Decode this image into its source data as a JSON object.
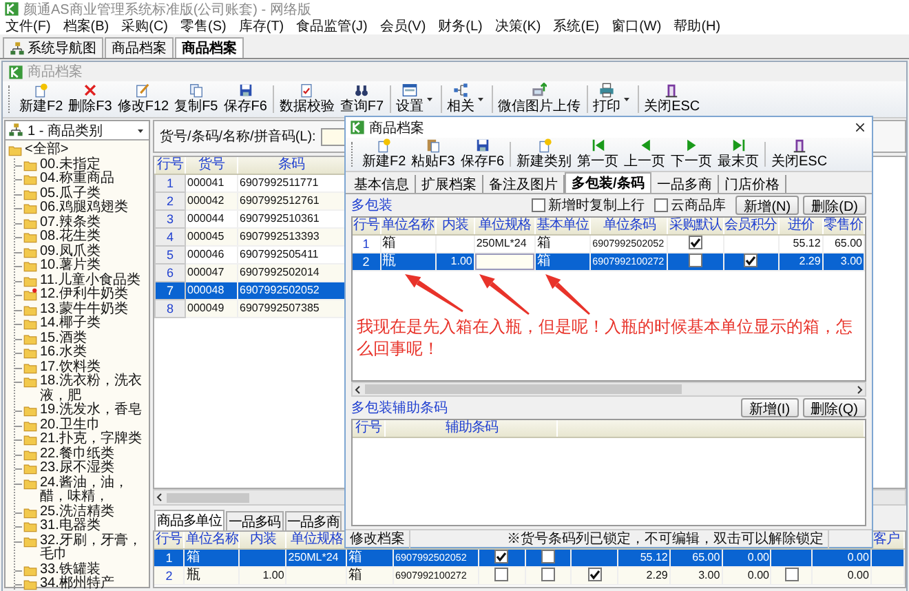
{
  "app_title": "颜通AS商业管理系统标准版(公司账套) - 网络版",
  "menu": [
    "文件(F)",
    "档案(B)",
    "采购(C)",
    "零售(S)",
    "库存(T)",
    "食品监管(J)",
    "会员(V)",
    "财务(L)",
    "决策(K)",
    "系统(E)",
    "窗口(W)",
    "帮助(H)"
  ],
  "doc_tabs": [
    {
      "label": "系统导航图",
      "kind": "navigator",
      "selected": false
    },
    {
      "label": "商品档案",
      "kind": "document",
      "selected": false
    },
    {
      "label": "商品档案",
      "kind": "document",
      "selected": true
    }
  ],
  "window": {
    "title": "商品档案",
    "toolbar": [
      {
        "label": "新建F2",
        "kind": "new",
        "group_start": false,
        "dropdown": false
      },
      {
        "label": "删除F3",
        "kind": "delete",
        "group_start": false,
        "dropdown": false
      },
      {
        "label": "修改F12",
        "kind": "edit",
        "group_start": false,
        "dropdown": false
      },
      {
        "label": "复制F5",
        "kind": "copy",
        "group_start": false,
        "dropdown": false
      },
      {
        "label": "保存F6",
        "kind": "save",
        "group_start": false,
        "dropdown": false
      },
      {
        "label": "数据校验",
        "kind": "verify",
        "group_start": true,
        "dropdown": false
      },
      {
        "label": "查询F7",
        "kind": "find",
        "group_start": false,
        "dropdown": false
      },
      {
        "label": "设置",
        "kind": "settings",
        "group_start": true,
        "dropdown": true
      },
      {
        "label": "相关",
        "kind": "related",
        "group_start": true,
        "dropdown": true
      },
      {
        "label": "微信图片上传",
        "kind": "upload",
        "group_start": true,
        "dropdown": false
      },
      {
        "label": "打印",
        "kind": "print",
        "group_start": true,
        "dropdown": true
      },
      {
        "label": "关闭ESC",
        "kind": "close",
        "group_start": true,
        "dropdown": false
      }
    ],
    "category_select": "1 - 商品类别",
    "tree": {
      "label": "<全部>",
      "expanded": true,
      "children": [
        {
          "label": "00.未指定",
          "marked": false
        },
        {
          "label": "04.称重商品",
          "marked": false
        },
        {
          "label": "05.瓜子类",
          "marked": false
        },
        {
          "label": "06.鸡腿鸡翅类",
          "marked": false
        },
        {
          "label": "07.辣条类",
          "marked": false
        },
        {
          "label": "08.花生类",
          "marked": false
        },
        {
          "label": "09.凤爪类",
          "marked": false
        },
        {
          "label": "10.薯片类",
          "marked": false
        },
        {
          "label": "11.儿童小食品类",
          "marked": false
        },
        {
          "label": "12.伊利牛奶类",
          "marked": true
        },
        {
          "label": "13.蒙牛牛奶类",
          "marked": false
        },
        {
          "label": "14.椰子类",
          "marked": false
        },
        {
          "label": "15.酒类",
          "marked": false
        },
        {
          "label": "16.水类",
          "marked": false
        },
        {
          "label": "17.饮料类",
          "marked": false
        },
        {
          "label": "18.洗衣粉，洗衣液，肥",
          "marked": false
        },
        {
          "label": "19.洗发水，香皂",
          "marked": false
        },
        {
          "label": "20.卫生巾",
          "marked": false
        },
        {
          "label": "21.扑克，字牌类",
          "marked": false
        },
        {
          "label": "22.餐巾纸类",
          "marked": false
        },
        {
          "label": "23.尿不湿类",
          "marked": false
        },
        {
          "label": "24.酱油，油，醋，味精，",
          "marked": false
        },
        {
          "label": "25.洗洁精类",
          "marked": false
        },
        {
          "label": "31.电器类",
          "marked": false
        },
        {
          "label": "32.牙刷，牙膏，毛巾",
          "marked": false
        },
        {
          "label": "33.铁罐装",
          "marked": false
        },
        {
          "label": "34.郴州特产",
          "marked": false
        }
      ]
    },
    "search": {
      "label": "货号/条码/名称/拼音码(L):"
    },
    "table": {
      "columns": [
        "行号",
        "货号",
        "条码"
      ],
      "rows": [
        {
          "cells": [
            "1",
            "000041",
            "6907992511771"
          ],
          "selected": false
        },
        {
          "cells": [
            "2",
            "000042",
            "6907992512761"
          ],
          "selected": false
        },
        {
          "cells": [
            "3",
            "000044",
            "6907992510361"
          ],
          "selected": false
        },
        {
          "cells": [
            "4",
            "000045",
            "6907992513393"
          ],
          "selected": false
        },
        {
          "cells": [
            "5",
            "000046",
            "6907992505411"
          ],
          "selected": false
        },
        {
          "cells": [
            "6",
            "000047",
            "6907992502014"
          ],
          "selected": false
        },
        {
          "cells": [
            "7",
            "000048",
            "6907992502052"
          ],
          "selected": true
        },
        {
          "cells": [
            "8",
            "000049",
            "6907992507385"
          ],
          "selected": false
        }
      ]
    },
    "bottom_tabs": [
      {
        "label": "商品多单位",
        "selected": true
      },
      {
        "label": "一品多码",
        "selected": false
      },
      {
        "label": "一品多商",
        "selected": false
      }
    ],
    "bottom_table": {
      "columns": [
        "行号",
        "单位名称",
        "内装",
        "单位规格"
      ],
      "last_column": "客户",
      "rows": [
        {
          "selected": true,
          "cells": [
            "1",
            "箱",
            null,
            "250ML*24",
            "箱",
            "6907992502052",
            {
              "kind": "check",
              "checked": true
            },
            {
              "kind": "check",
              "checked": false
            },
            null,
            "55.12",
            "65.00",
            "0.00",
            null,
            "0.00"
          ]
        },
        {
          "selected": false,
          "cells": [
            "2",
            "瓶",
            "1.00",
            null,
            "箱",
            "6907992100272",
            {
              "kind": "check",
              "checked": false
            },
            {
              "kind": "check",
              "checked": false
            },
            {
              "kind": "check",
              "checked": true
            },
            "2.29",
            "3.00",
            "0.00",
            {
              "kind": "check",
              "checked": false
            },
            "0.00"
          ]
        }
      ]
    }
  },
  "dialog": {
    "title": "商品档案",
    "toolbar": [
      {
        "label": "新建F2",
        "kind": "new",
        "group_start": false
      },
      {
        "label": "粘贴F3",
        "kind": "paste",
        "group_start": false
      },
      {
        "label": "保存F6",
        "kind": "save",
        "group_start": false
      },
      {
        "label": "新建类别",
        "kind": "new",
        "group_start": true
      },
      {
        "label": "第一页",
        "kind": "first",
        "group_start": false
      },
      {
        "label": "上一页",
        "kind": "prev",
        "group_start": false
      },
      {
        "label": "下一页",
        "kind": "next",
        "group_start": false
      },
      {
        "label": "最末页",
        "kind": "last",
        "group_start": false
      },
      {
        "label": "关闭ESC",
        "kind": "close",
        "group_start": true
      }
    ],
    "tabs": [
      {
        "label": "基本信息",
        "selected": false
      },
      {
        "label": "扩展档案",
        "selected": false
      },
      {
        "label": "备注及图片",
        "selected": false
      },
      {
        "label": "多包装/条码",
        "selected": true
      },
      {
        "label": "一品多商",
        "selected": false
      },
      {
        "label": "门店价格",
        "selected": false
      }
    ],
    "options": [
      {
        "label": "新增时复制上行",
        "checked": false
      },
      {
        "label": "云商品库",
        "checked": false
      }
    ],
    "section": {
      "title": "多包装",
      "buttons": [
        "新增(N)",
        "删除(D)"
      ]
    },
    "table": {
      "columns": [
        "行号",
        "单位名称",
        "内装",
        "单位规格",
        "基本单位",
        "单位条码",
        "采购默认",
        "会员积分",
        "进价",
        "零售价"
      ],
      "rows": [
        {
          "selected": false,
          "cells": [
            "1",
            "箱",
            null,
            "250ML*24",
            "箱",
            "6907992502052",
            {
              "kind": "check",
              "checked": true
            },
            null,
            "55.12",
            "65.00"
          ]
        },
        {
          "selected": true,
          "cells": [
            "2",
            "瓶",
            "1.00",
            {
              "kind": "input"
            },
            "箱",
            "6907992100272",
            {
              "kind": "check",
              "checked": false
            },
            {
              "kind": "check",
              "checked": true
            },
            "2.29",
            "3.00"
          ]
        }
      ]
    },
    "annotation": {
      "text": "我现在是先入箱在入瓶，但是呢！入瓶的时候基本单位显示的箱，怎么回事呢！"
    },
    "section2": {
      "title": "多包装辅助条码",
      "buttons": [
        "新增(I)",
        "删除(Q)"
      ]
    },
    "table2": {
      "columns": [
        "行号",
        "辅助条码"
      ]
    },
    "status_bar": [
      "修改档案",
      "※货号条码列已锁定，不可编辑，双击可以解除锁定"
    ]
  }
}
